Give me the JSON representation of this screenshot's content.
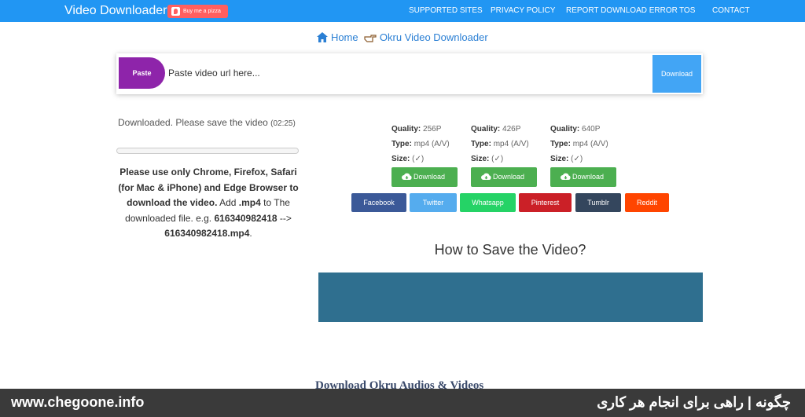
{
  "nav": {
    "brand": "Video Downloader",
    "pizza_label": "Buy me a pizza",
    "links": [
      "SUPPORTED SITES",
      "PRIVACY POLICY",
      "REPORT DOWNLOAD ERROR",
      "TOS",
      "CONTACT"
    ]
  },
  "breadcrumb": {
    "home": "Home",
    "current": "Okru Video Downloader"
  },
  "urlbar": {
    "paste_label": "Paste",
    "placeholder": "Paste video url here...",
    "download_label": "Download"
  },
  "status": {
    "text": "Downloaded. Please save the video",
    "time": "(02:25)",
    "progress": 0
  },
  "notice": {
    "part1": "Please use only Chrome, Firefox, Safari (for Mac & iPhone) and Edge Browser to download the video.",
    "part2": " Add ",
    "ext": ".mp4",
    "part3": " to The downloaded file. e.g. ",
    "example_from": "616340982418",
    "arrow": " --> ",
    "example_to": "616340982418.mp4",
    "period": "."
  },
  "qualities": [
    {
      "quality_label": "Quality:",
      "quality": "256P",
      "type_label": "Type:",
      "type": "mp4 (A/V)",
      "size_label": "Size:",
      "size": "(✓)",
      "button": "Download"
    },
    {
      "quality_label": "Quality:",
      "quality": "426P",
      "type_label": "Type:",
      "type": "mp4 (A/V)",
      "size_label": "Size:",
      "size": "(✓)",
      "button": "Download"
    },
    {
      "quality_label": "Quality:",
      "quality": "640P",
      "type_label": "Type:",
      "type": "mp4 (A/V)",
      "size_label": "Size:",
      "size": "(✓)",
      "button": "Download"
    }
  ],
  "share": [
    {
      "label": "Facebook",
      "color": "#3b5998"
    },
    {
      "label": "Twitter",
      "color": "#55acee"
    },
    {
      "label": "Whatsapp",
      "color": "#25d366"
    },
    {
      "label": "Pinterest",
      "color": "#cb2027"
    },
    {
      "label": "Tumblr",
      "color": "#34465d"
    },
    {
      "label": "Reddit",
      "color": "#ff4500"
    }
  ],
  "howto_title": "How to Save the Video?",
  "section_title": "Download Okru Audios & Videos",
  "footer": {
    "left": "www.chegoone.info",
    "right": "چگونه | راهی برای انجام هر کاری"
  },
  "colors": {
    "accent": "#2196f3",
    "paste": "#8e24aa",
    "download_green": "#4caf50",
    "video_box": "#2f6f8f"
  }
}
